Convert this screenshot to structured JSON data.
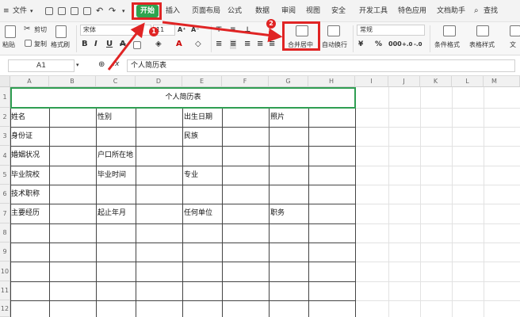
{
  "menubar": {
    "file_label": "文件",
    "tabs": [
      "开始",
      "插入",
      "页面布局",
      "公式",
      "数据",
      "审阅",
      "视图",
      "安全",
      "开发工具",
      "特色应用",
      "文档助手"
    ],
    "search_label": "查找"
  },
  "ribbon": {
    "paste_label": "粘贴",
    "cut_label": "剪切",
    "copy_label": "复制",
    "format_painter_label": "格式刷",
    "font_name": "宋体",
    "font_size": "11",
    "merge_center_label": "合并居中",
    "wrap_text_label": "自动换行",
    "number_format": "常规",
    "conditional_format_label": "条件格式",
    "table_style_label": "表格样式",
    "doc_label": "文"
  },
  "formulabar": {
    "cell_ref": "A1",
    "fx": "fx",
    "formula": "个人简历表"
  },
  "grid": {
    "columns": [
      "A",
      "B",
      "C",
      "D",
      "E",
      "F",
      "G",
      "H",
      "I",
      "J",
      "K",
      "L",
      "M"
    ],
    "rows": [
      "1",
      "2",
      "3",
      "4",
      "5",
      "6",
      "7",
      "8",
      "9",
      "10",
      "11",
      "12"
    ],
    "title": "个人简历表",
    "cells": {
      "name": "姓名",
      "gender": "性别",
      "birth": "出生日期",
      "photo": "照片",
      "id": "身份证",
      "ethnicity": "民族",
      "marital": "婚姻状况",
      "hukou": "户口所在地",
      "school": "毕业院校",
      "grad_time": "毕业时间",
      "major": "专业",
      "title": "技术职称",
      "experience": "主要经历",
      "period": "起止年月",
      "employer": "任何单位",
      "position": "职务"
    }
  },
  "annotations": {
    "step1": "1",
    "step2": "2",
    "accent_color": "#e02424",
    "select_color": "#2f9e52"
  }
}
